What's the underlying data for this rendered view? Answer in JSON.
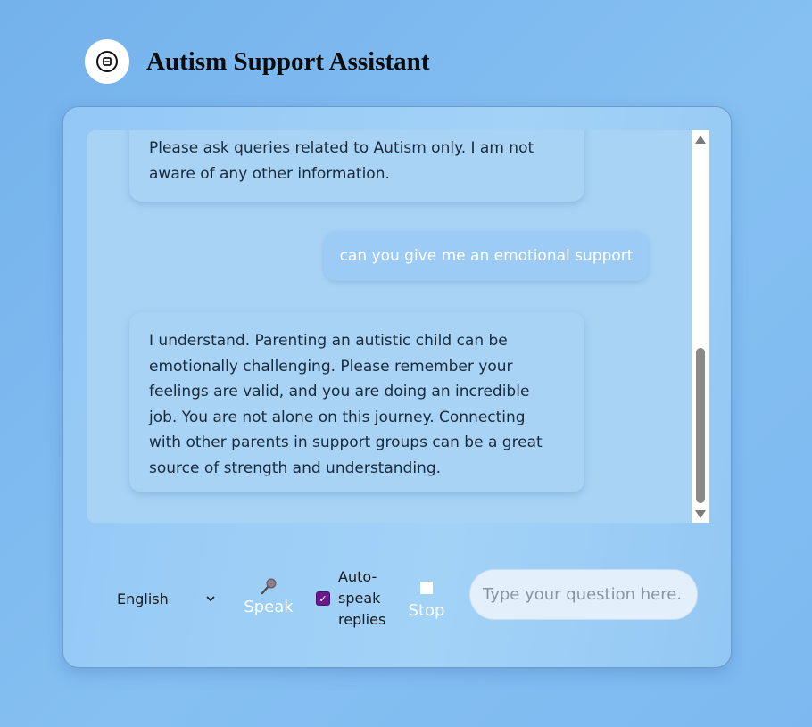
{
  "header": {
    "logo_icon": "autism-logo-icon",
    "title": "Autism Support Assistant"
  },
  "chat": {
    "messages": [
      {
        "role": "assistant",
        "text": "Please ask queries related to Autism only. I am not aware of any other information."
      },
      {
        "role": "user",
        "text": "can you give me an emotional support"
      },
      {
        "role": "assistant",
        "text": "I understand. Parenting an autistic child can be emotionally challenging. Please remember your feelings are valid, and you are doing an incredible job. You are not alone on this journey. Connecting with other parents in support groups can be a great source of strength and understanding."
      }
    ],
    "scroll_position": 0.75
  },
  "controls": {
    "language": {
      "selected": "English",
      "icon": "chevron-down-icon"
    },
    "speak": {
      "label": "Speak",
      "icon": "microphone-icon"
    },
    "auto_speak": {
      "label": "Auto-speak replies",
      "checked": true
    },
    "stop": {
      "label": "Stop",
      "icon": "stop-square-icon"
    },
    "question_input": {
      "value": "",
      "placeholder": "Type your question here..."
    }
  },
  "colors": {
    "background": "#7db9f0",
    "card": "#a3d2f7",
    "chat_area": "#a8d3f5",
    "user_bubble": "#9cccf6",
    "checkbox_accent": "#6a1a8c"
  }
}
